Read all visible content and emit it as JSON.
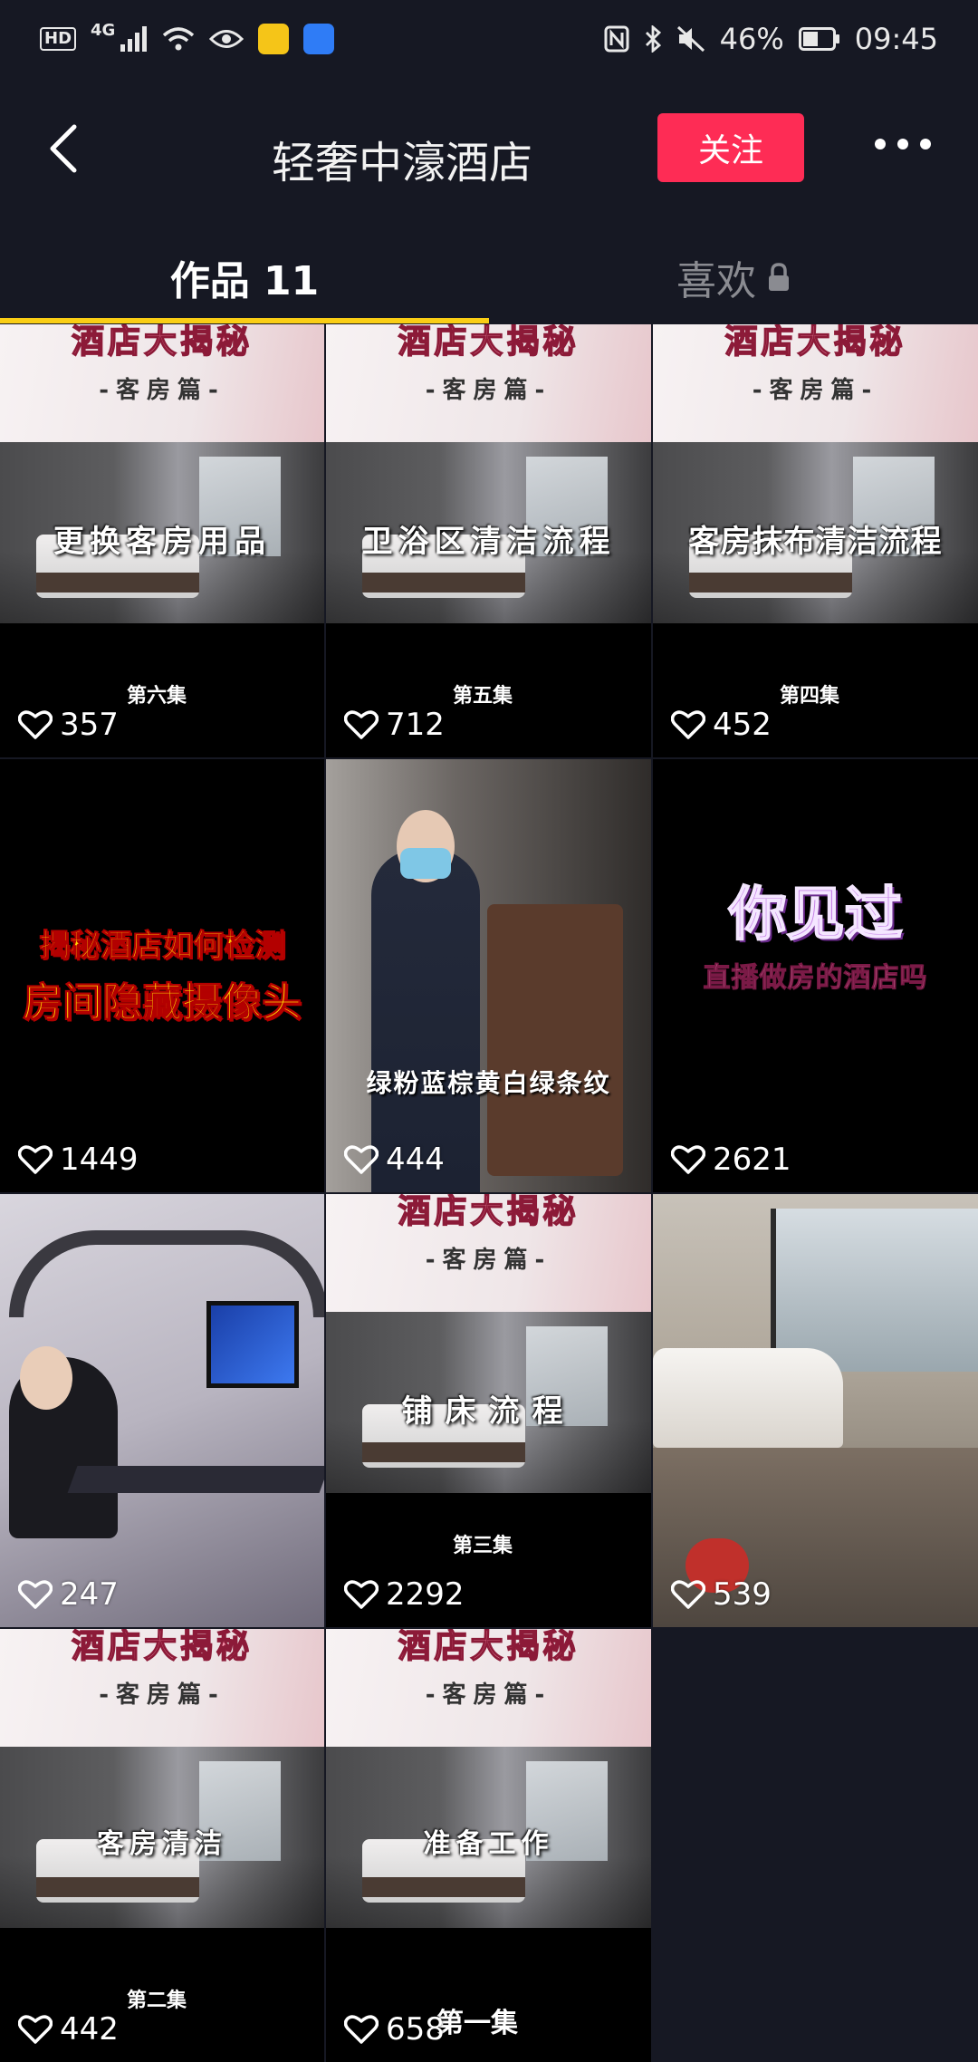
{
  "status_bar": {
    "left": {
      "hd": "HD",
      "network": "4G"
    },
    "right": {
      "battery": "46%",
      "time": "09:45"
    }
  },
  "header": {
    "title": "轻奢中濠酒店",
    "follow_label": "关注"
  },
  "tabs": {
    "works_label": "作品 11",
    "likes_label": "喜欢"
  },
  "series_banner": {
    "title": "酒店大揭秘",
    "subtitle": "-客房篇-"
  },
  "videos": [
    {
      "overlay": "更换客房用品",
      "episode": "第六集",
      "likes": "357"
    },
    {
      "overlay": "卫浴区清洁流程",
      "episode": "第五集",
      "likes": "712"
    },
    {
      "overlay": "客房抹布清洁流程",
      "episode": "第四集",
      "likes": "452"
    },
    {
      "line1": "揭秘酒店如何检测",
      "line2": "房间隐藏摄像头",
      "likes": "1449"
    },
    {
      "caption": "绿粉蓝棕黄白绿条纹",
      "likes": "444"
    },
    {
      "line1": "你见过",
      "line2": "直播做房的酒店吗",
      "likes": "2621"
    },
    {
      "likes": "247"
    },
    {
      "overlay": "铺床流程",
      "episode": "第三集",
      "likes": "2292"
    },
    {
      "likes": "539"
    },
    {
      "overlay": "客房清洁",
      "episode": "第二集",
      "likes": "442"
    },
    {
      "overlay": "准备工作",
      "episode": "第一集",
      "likes": "658"
    }
  ]
}
